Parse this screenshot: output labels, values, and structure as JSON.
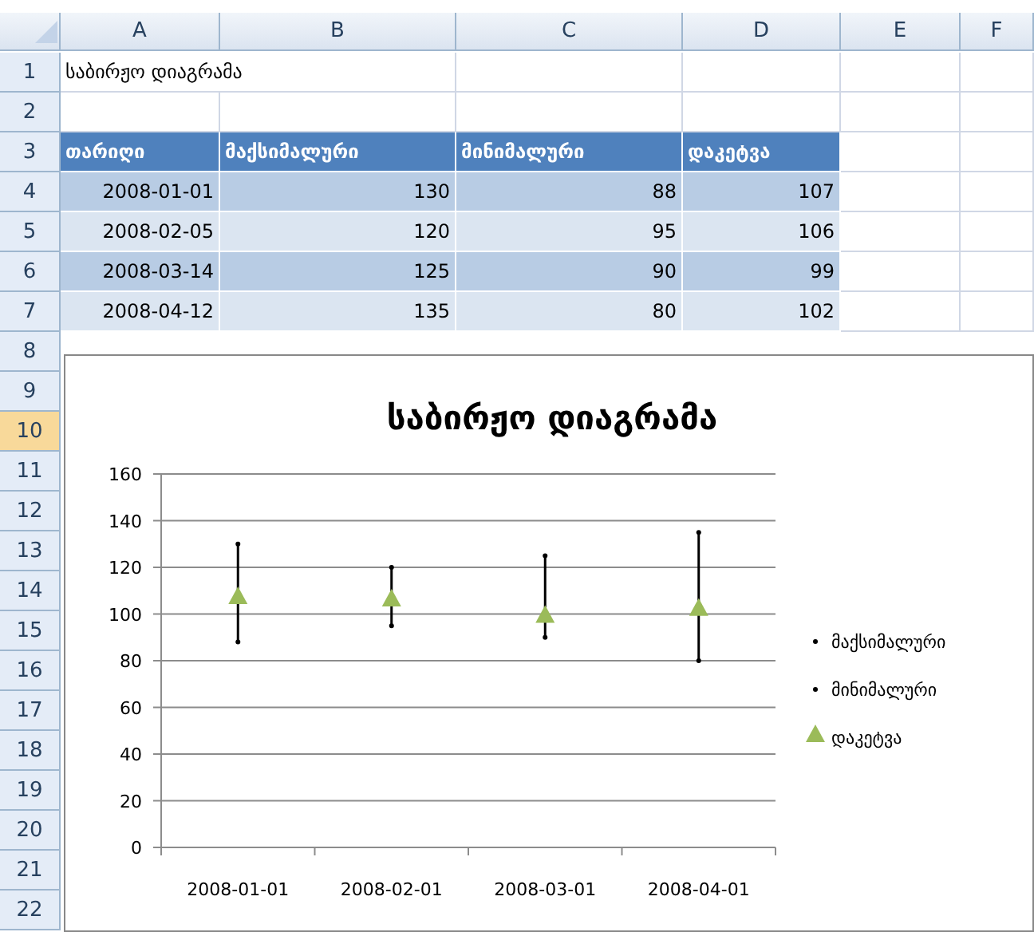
{
  "sheet": {
    "columns": [
      "A",
      "B",
      "C",
      "D",
      "E",
      "F"
    ],
    "rows": [
      {
        "number": "1",
        "selected": false
      },
      {
        "number": "2",
        "selected": false
      },
      {
        "number": "3",
        "selected": false
      },
      {
        "number": "4",
        "selected": false
      },
      {
        "number": "5",
        "selected": false
      },
      {
        "number": "6",
        "selected": false
      },
      {
        "number": "7",
        "selected": false
      },
      {
        "number": "8",
        "selected": false
      },
      {
        "number": "9",
        "selected": false
      },
      {
        "number": "10",
        "selected": true
      },
      {
        "number": "11",
        "selected": false
      },
      {
        "number": "12",
        "selected": false
      },
      {
        "number": "13",
        "selected": false
      },
      {
        "number": "14",
        "selected": false
      },
      {
        "number": "15",
        "selected": false
      },
      {
        "number": "16",
        "selected": false
      },
      {
        "number": "17",
        "selected": false
      },
      {
        "number": "18",
        "selected": false
      },
      {
        "number": "19",
        "selected": false
      },
      {
        "number": "20",
        "selected": false
      },
      {
        "number": "21",
        "selected": false
      },
      {
        "number": "22",
        "selected": false
      }
    ],
    "title_cell": "საბირჟო დიაგრამა",
    "table": {
      "columns": [
        "თარიღი",
        "მაქსიმალური",
        "მინიმალური",
        "დაკეტვა"
      ],
      "rows": [
        [
          "2008-01-01",
          "130",
          "88",
          "107"
        ],
        [
          "2008-02-05",
          "120",
          "95",
          "106"
        ],
        [
          "2008-03-14",
          "125",
          "90",
          "99"
        ],
        [
          "2008-04-12",
          "135",
          "80",
          "102"
        ]
      ]
    }
  },
  "chart": {
    "chart_data": {
      "type": "scatter",
      "title": "საბირჟო დიაგრამა",
      "categories": [
        "2008-01-01",
        "2008-02-01",
        "2008-03-01",
        "2008-04-01"
      ],
      "grid": true,
      "legend": "right",
      "series": [
        {
          "name": "მაქსიმალური",
          "color": "#000000",
          "marker": "circle",
          "values": [
            130,
            120,
            125,
            135
          ]
        },
        {
          "name": "მინიმალური",
          "color": "#000000",
          "marker": "circle",
          "values": [
            88,
            95,
            90,
            80
          ]
        },
        {
          "name": "დაკეტვა",
          "color": "#9bbb59",
          "marker": "triangle",
          "values": [
            107,
            106,
            99,
            102
          ]
        }
      ],
      "ylim": [
        0,
        160
      ],
      "yticks": [
        0,
        20,
        40,
        60,
        80,
        100,
        120,
        140,
        160
      ]
    }
  }
}
